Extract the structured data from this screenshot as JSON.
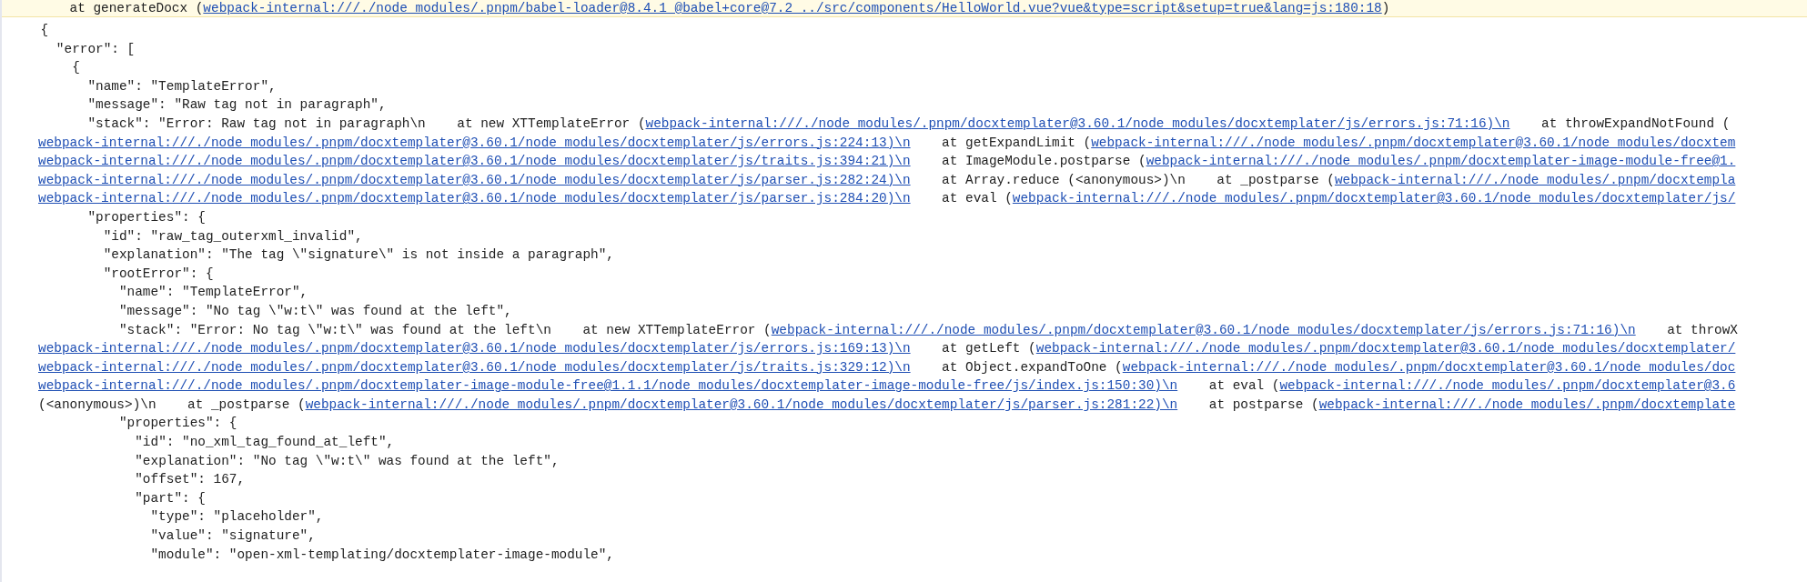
{
  "warning_line": {
    "segments": [
      {
        "kind": "text",
        "text": "    at generateDocx ("
      },
      {
        "kind": "link",
        "text": "webpack-internal:///./node_modules/.pnpm/babel-loader@8.4.1_@babel+core@7.2_../src/components/HelloWorld.vue?vue&type=script&setup=true&lang=js:180:18"
      },
      {
        "kind": "text",
        "text": ")"
      }
    ]
  },
  "lines": [
    {
      "segments": [
        {
          "kind": "text",
          "text": "{"
        }
      ],
      "children": [
        {
          "segments": [
            {
              "kind": "text",
              "text": "\"error\": ["
            }
          ],
          "children": [
            {
              "segments": [
                {
                  "kind": "text",
                  "text": "{"
                }
              ],
              "children": [
                {
                  "segments": [
                    {
                      "kind": "text",
                      "text": "\"name\": \"TemplateError\","
                    }
                  ]
                },
                {
                  "segments": [
                    {
                      "kind": "text",
                      "text": "\"message\": \"Raw tag not in paragraph\","
                    }
                  ]
                },
                {
                  "segments": [
                    {
                      "kind": "text",
                      "text": "\"stack\": \"Error: Raw tag not in paragraph\\n    at new XTTemplateError ("
                    },
                    {
                      "kind": "link",
                      "text": "webpack-internal:///./node_modules/.pnpm/docxtemplater@3.60.1/node_modules/docxtemplater/js/errors.js:71:16)\\n"
                    },
                    {
                      "kind": "text",
                      "text": "    at throwExpandNotFound ("
                    }
                  ],
                  "wrapped": [
                    {
                      "segments": [
                        {
                          "kind": "link",
                          "text": "webpack-internal:///./node_modules/.pnpm/docxtemplater@3.60.1/node_modules/docxtemplater/js/errors.js:224:13)\\n"
                        },
                        {
                          "kind": "text",
                          "text": "    at getExpandLimit ("
                        },
                        {
                          "kind": "link",
                          "text": "webpack-internal:///./node_modules/.pnpm/docxtemplater@3.60.1/node_modules/docxtem"
                        }
                      ]
                    },
                    {
                      "segments": [
                        {
                          "kind": "link",
                          "text": "webpack-internal:///./node_modules/.pnpm/docxtemplater@3.60.1/node_modules/docxtemplater/js/traits.js:394:21)\\n"
                        },
                        {
                          "kind": "text",
                          "text": "    at ImageModule.postparse ("
                        },
                        {
                          "kind": "link",
                          "text": "webpack-internal:///./node_modules/.pnpm/docxtemplater-image-module-free@1."
                        }
                      ]
                    },
                    {
                      "segments": [
                        {
                          "kind": "link",
                          "text": "webpack-internal:///./node_modules/.pnpm/docxtemplater@3.60.1/node_modules/docxtemplater/js/parser.js:282:24)\\n"
                        },
                        {
                          "kind": "text",
                          "text": "    at Array.reduce (<anonymous>)\\n    at _postparse ("
                        },
                        {
                          "kind": "link",
                          "text": "webpack-internal:///./node_modules/.pnpm/docxtempla"
                        }
                      ]
                    },
                    {
                      "segments": [
                        {
                          "kind": "link",
                          "text": "webpack-internal:///./node_modules/.pnpm/docxtemplater@3.60.1/node_modules/docxtemplater/js/parser.js:284:20)\\n"
                        },
                        {
                          "kind": "text",
                          "text": "    at eval ("
                        },
                        {
                          "kind": "link",
                          "text": "webpack-internal:///./node_modules/.pnpm/docxtemplater@3.60.1/node_modules/docxtemplater/js/"
                        }
                      ]
                    }
                  ]
                },
                {
                  "segments": [
                    {
                      "kind": "text",
                      "text": "\"properties\": {"
                    }
                  ],
                  "children": [
                    {
                      "segments": [
                        {
                          "kind": "text",
                          "text": "\"id\": \"raw_tag_outerxml_invalid\","
                        }
                      ]
                    },
                    {
                      "segments": [
                        {
                          "kind": "text",
                          "text": "\"explanation\": \"The tag \\\"signature\\\" is not inside a paragraph\","
                        }
                      ]
                    },
                    {
                      "segments": [
                        {
                          "kind": "text",
                          "text": "\"rootError\": {"
                        }
                      ],
                      "children": [
                        {
                          "segments": [
                            {
                              "kind": "text",
                              "text": "\"name\": \"TemplateError\","
                            }
                          ]
                        },
                        {
                          "segments": [
                            {
                              "kind": "text",
                              "text": "\"message\": \"No tag \\\"w:t\\\" was found at the left\","
                            }
                          ]
                        },
                        {
                          "segments": [
                            {
                              "kind": "text",
                              "text": "\"stack\": \"Error: No tag \\\"w:t\\\" was found at the left\\n    at new XTTemplateError ("
                            },
                            {
                              "kind": "link",
                              "text": "webpack-internal:///./node_modules/.pnpm/docxtemplater@3.60.1/node_modules/docxtemplater/js/errors.js:71:16)\\n"
                            },
                            {
                              "kind": "text",
                              "text": "    at throwX"
                            }
                          ],
                          "wrapped": [
                            {
                              "segments": [
                                {
                                  "kind": "link",
                                  "text": "webpack-internal:///./node_modules/.pnpm/docxtemplater@3.60.1/node_modules/docxtemplater/js/errors.js:169:13)\\n"
                                },
                                {
                                  "kind": "text",
                                  "text": "    at getLeft ("
                                },
                                {
                                  "kind": "link",
                                  "text": "webpack-internal:///./node_modules/.pnpm/docxtemplater@3.60.1/node_modules/docxtemplater/"
                                }
                              ]
                            },
                            {
                              "segments": [
                                {
                                  "kind": "link",
                                  "text": "webpack-internal:///./node_modules/.pnpm/docxtemplater@3.60.1/node_modules/docxtemplater/js/traits.js:329:12)\\n"
                                },
                                {
                                  "kind": "text",
                                  "text": "    at Object.expandToOne ("
                                },
                                {
                                  "kind": "link",
                                  "text": "webpack-internal:///./node_modules/.pnpm/docxtemplater@3.60.1/node_modules/doc"
                                }
                              ]
                            },
                            {
                              "segments": [
                                {
                                  "kind": "link",
                                  "text": "webpack-internal:///./node_modules/.pnpm/docxtemplater-image-module-free@1.1.1/node_modules/docxtemplater-image-module-free/js/index.js:150:30)\\n"
                                },
                                {
                                  "kind": "text",
                                  "text": "    at eval ("
                                },
                                {
                                  "kind": "link",
                                  "text": "webpack-internal:///./node_modules/.pnpm/docxtemplater@3.6"
                                }
                              ]
                            },
                            {
                              "segments": [
                                {
                                  "kind": "text",
                                  "text": "(<anonymous>)\\n    at _postparse ("
                                },
                                {
                                  "kind": "link",
                                  "text": "webpack-internal:///./node_modules/.pnpm/docxtemplater@3.60.1/node_modules/docxtemplater/js/parser.js:281:22)\\n"
                                },
                                {
                                  "kind": "text",
                                  "text": "    at postparse ("
                                },
                                {
                                  "kind": "link",
                                  "text": "webpack-internal:///./node_modules/.pnpm/docxtemplate"
                                }
                              ]
                            }
                          ]
                        },
                        {
                          "segments": [
                            {
                              "kind": "text",
                              "text": "\"properties\": {"
                            }
                          ],
                          "children": [
                            {
                              "segments": [
                                {
                                  "kind": "text",
                                  "text": "\"id\": \"no_xml_tag_found_at_left\","
                                }
                              ]
                            },
                            {
                              "segments": [
                                {
                                  "kind": "text",
                                  "text": "\"explanation\": \"No tag \\\"w:t\\\" was found at the left\","
                                }
                              ]
                            },
                            {
                              "segments": [
                                {
                                  "kind": "text",
                                  "text": "\"offset\": 167,"
                                }
                              ]
                            },
                            {
                              "segments": [
                                {
                                  "kind": "text",
                                  "text": "\"part\": {"
                                }
                              ],
                              "children": [
                                {
                                  "segments": [
                                    {
                                      "kind": "text",
                                      "text": "\"type\": \"placeholder\","
                                    }
                                  ]
                                },
                                {
                                  "segments": [
                                    {
                                      "kind": "text",
                                      "text": "\"value\": \"signature\","
                                    }
                                  ]
                                },
                                {
                                  "segments": [
                                    {
                                      "kind": "text",
                                      "text": "\"module\": \"open-xml-templating/docxtemplater-image-module\","
                                    }
                                  ]
                                }
                              ]
                            }
                          ]
                        }
                      ]
                    }
                  ]
                }
              ]
            }
          ]
        }
      ]
    }
  ]
}
